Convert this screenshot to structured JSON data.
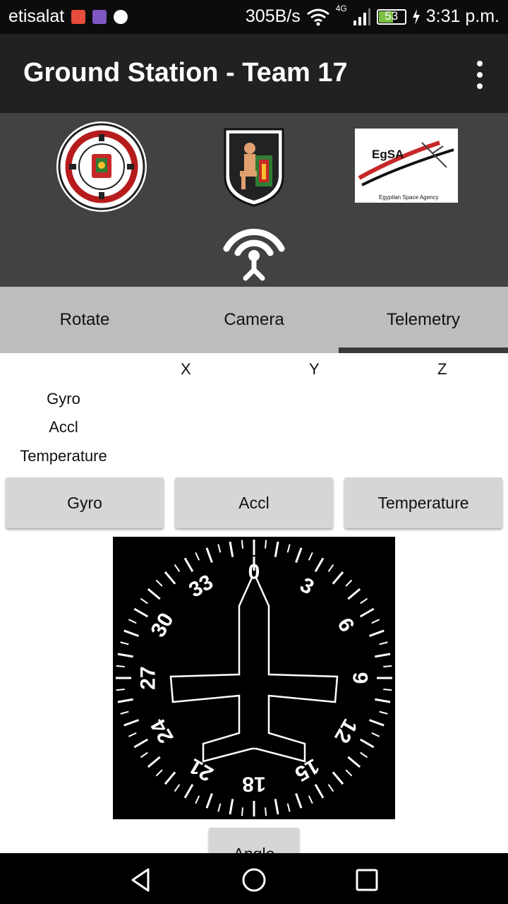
{
  "status_bar": {
    "carrier": "etisalat",
    "speed": "305B/s",
    "network": "4G",
    "battery": "53",
    "time": "3:31 p.m."
  },
  "app_bar": {
    "title": "Ground Station - Team 17",
    "overflow_icon": "more-vert-icon"
  },
  "header": {
    "logos": [
      "university-seal-logo",
      "pharaoh-shield-logo",
      "egsa-logo"
    ],
    "egsa_text": "EgSA",
    "egsa_caption": "Egyptian Space Agency",
    "seal_text": "FOUNDED IN 1816",
    "signal_icon": "wireless-antenna-icon"
  },
  "tabs": [
    {
      "label": "Rotate",
      "active": false
    },
    {
      "label": "Camera",
      "active": false
    },
    {
      "label": "Telemetry",
      "active": true
    }
  ],
  "telemetry": {
    "columns": [
      "X",
      "Y",
      "Z"
    ],
    "rows": [
      "Gyro",
      "Accl",
      "Temperature"
    ]
  },
  "buttons": {
    "gyro": "Gyro",
    "accl": "Accl",
    "temperature": "Temperature",
    "angle": "Angle"
  },
  "compass": {
    "heading": 0,
    "labels": [
      "0",
      "3",
      "6",
      "9",
      "12",
      "15",
      "18",
      "21",
      "24",
      "27",
      "30",
      "33"
    ]
  },
  "nav_bar": {
    "icons": [
      "back-icon",
      "home-icon",
      "recents-icon"
    ]
  }
}
